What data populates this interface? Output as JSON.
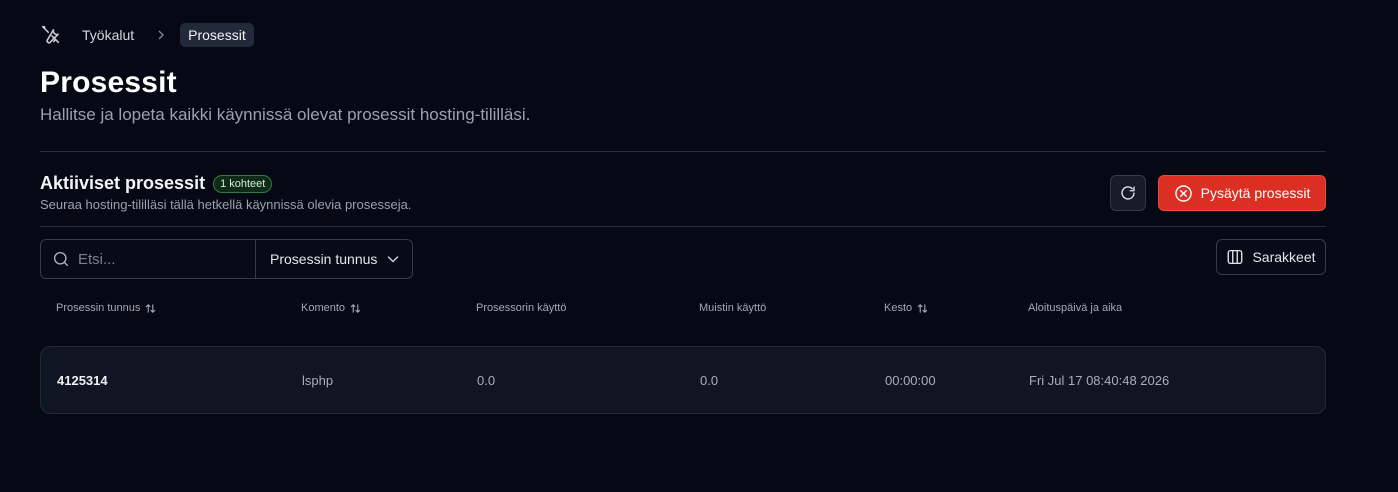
{
  "breadcrumb": {
    "icon": "tools-icon",
    "parent": "Työkalut",
    "current": "Prosessit"
  },
  "header": {
    "title": "Prosessit",
    "subtitle": "Hallitse ja lopeta kaikki käynnissä olevat prosessit hosting-tililläsi."
  },
  "section": {
    "title": "Aktiiviset prosessit",
    "badge": "1 kohteet",
    "description": "Seuraa hosting-tililläsi tällä hetkellä käynnissä olevia prosesseja."
  },
  "actions": {
    "refresh_icon": "refresh-icon",
    "kill_label": "Pysäytä prosessit",
    "kill_color": "#dc2f24"
  },
  "filters": {
    "search_placeholder": "Etsi...",
    "search_value": "",
    "filter_selected": "Prosessin tunnus",
    "columns_label": "Sarakkeet"
  },
  "table": {
    "columns": [
      {
        "label": "Prosessin tunnus",
        "sortable": true
      },
      {
        "label": "Komento",
        "sortable": true
      },
      {
        "label": "Prosessorin käyttö",
        "sortable": false
      },
      {
        "label": "Muistin käyttö",
        "sortable": false
      },
      {
        "label": "Kesto",
        "sortable": true
      },
      {
        "label": "Aloituspäivä ja aika",
        "sortable": false
      }
    ],
    "rows": [
      {
        "pid": "4125314",
        "command": "lsphp",
        "cpu": "0.0",
        "memory": "0.0",
        "duration": "00:00:00",
        "started": "Fri Jul 17 08:40:48 2026"
      }
    ]
  }
}
